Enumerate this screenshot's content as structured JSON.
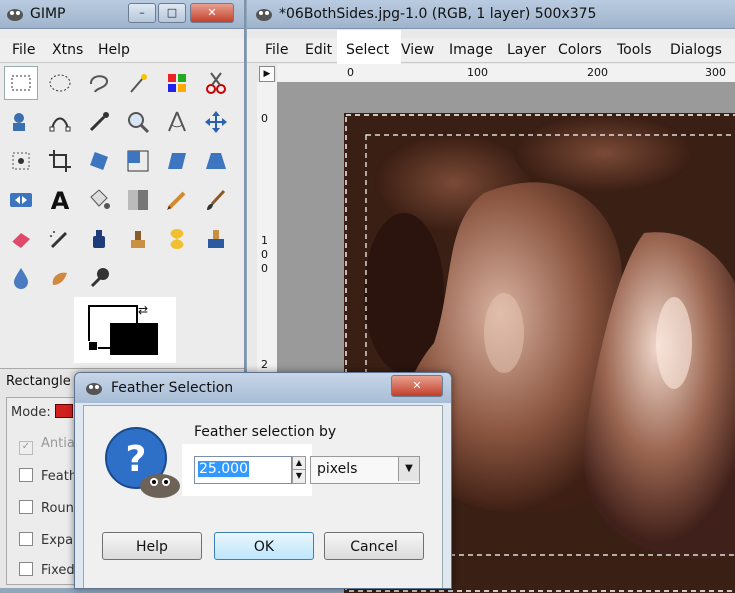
{
  "toolbox": {
    "title": "GIMP",
    "menu": {
      "file": "File",
      "xtns": "Xtns",
      "help": "Help"
    },
    "panel_title": "Rectangle",
    "options": [
      {
        "label": "Mode:",
        "type": "mode"
      },
      {
        "label": "Antial",
        "type": "checkbox-checked"
      },
      {
        "label": "Feathe",
        "type": "checkbox"
      },
      {
        "label": "Round",
        "type": "checkbox"
      },
      {
        "label": "Expan",
        "type": "checkbox"
      },
      {
        "label": "Fixed:",
        "type": "checkbox"
      }
    ],
    "tools": [
      "rect-select-icon",
      "ellipse-select-icon",
      "lasso-icon",
      "fuzzy-select-icon",
      "color-select-icon",
      "scissors-icon",
      "foreground-select-icon",
      "paths-icon",
      "color-picker-icon",
      "zoom-icon",
      "measure-icon",
      "move-icon",
      "align-icon",
      "crop-icon",
      "rotate-icon",
      "scale-icon",
      "shear-icon",
      "perspective-icon",
      "flip-icon",
      "text-icon",
      "bucket-fill-icon",
      "blend-icon",
      "pencil-icon",
      "paintbrush-icon",
      "eraser-icon",
      "airbrush-icon",
      "ink-icon",
      "clone-icon",
      "heal-icon",
      "perspective-clone-icon",
      "blur-icon",
      "smudge-icon",
      "dodge-burn-icon"
    ]
  },
  "image_window": {
    "title": "*06BothSides.jpg-1.0 (RGB, 1 layer) 500x375",
    "menu": [
      "File",
      "Edit",
      "Select",
      "View",
      "Image",
      "Layer",
      "Colors",
      "Tools",
      "Dialogs"
    ],
    "ruler_h": [
      "0",
      "100",
      "200",
      "300"
    ],
    "ruler_v_top": "0",
    "ruler_v_mid": [
      "1",
      "0",
      "0"
    ],
    "ruler_v_bottom": "2"
  },
  "dialog": {
    "title": "Feather Selection",
    "label": "Feather selection by",
    "value": "25.000",
    "unit": "pixels",
    "buttons": {
      "help": "Help",
      "ok": "OK",
      "cancel": "Cancel"
    }
  },
  "colors": {
    "accent": "#3399ff",
    "sepia": "#6b3a26",
    "titlebar": "#a7bcd6"
  }
}
